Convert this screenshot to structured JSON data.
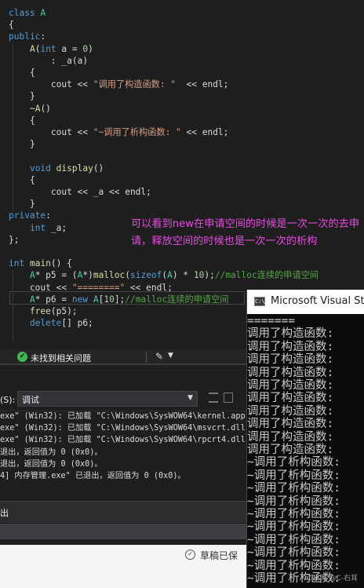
{
  "editor": {
    "lines": [
      [
        [
          "kw",
          "class"
        ],
        [
          "pl",
          " "
        ],
        [
          "ty",
          "A"
        ]
      ],
      [
        [
          "pl",
          "{"
        ]
      ],
      [
        [
          "kw",
          "public"
        ],
        [
          "pl",
          ":"
        ]
      ],
      [
        [
          "pl",
          "    "
        ],
        [
          "fn",
          "A"
        ],
        [
          "pl",
          "("
        ],
        [
          "kw",
          "int"
        ],
        [
          "pl",
          " a = "
        ],
        [
          "num",
          "0"
        ],
        [
          "pl",
          ")"
        ]
      ],
      [
        [
          "pl",
          "        : "
        ],
        [
          "mem",
          "_a"
        ],
        [
          "pl",
          "(a)"
        ]
      ],
      [
        [
          "pl",
          "    {"
        ]
      ],
      [
        [
          "pl",
          "        cout << "
        ],
        [
          "str",
          "\"调用了构造函数: \""
        ],
        [
          "pl",
          "  << endl;"
        ]
      ],
      [
        [
          "pl",
          "    }"
        ]
      ],
      [
        [
          "pl",
          "    ~"
        ],
        [
          "fn",
          "A"
        ],
        [
          "pl",
          "()"
        ]
      ],
      [
        [
          "pl",
          "    {"
        ]
      ],
      [
        [
          "pl",
          "        cout << "
        ],
        [
          "str",
          "\"~调用了析构函数: \""
        ],
        [
          "pl",
          " << endl;"
        ]
      ],
      [
        [
          "pl",
          "    }"
        ]
      ],
      [
        [
          "pl",
          ""
        ]
      ],
      [
        [
          "pl",
          "    "
        ],
        [
          "kw",
          "void"
        ],
        [
          "pl",
          " "
        ],
        [
          "fn",
          "display"
        ],
        [
          "pl",
          "()"
        ]
      ],
      [
        [
          "pl",
          "    {"
        ]
      ],
      [
        [
          "pl",
          "        cout << "
        ],
        [
          "mem",
          "_a"
        ],
        [
          "pl",
          " << endl;"
        ]
      ],
      [
        [
          "pl",
          "    }"
        ]
      ],
      [
        [
          "kw",
          "private"
        ],
        [
          "pl",
          ":"
        ]
      ],
      [
        [
          "pl",
          "    "
        ],
        [
          "kw",
          "int"
        ],
        [
          "pl",
          " "
        ],
        [
          "mem",
          "_a"
        ],
        [
          "pl",
          ";"
        ]
      ],
      [
        [
          "pl",
          "};"
        ]
      ],
      [
        [
          "pl",
          ""
        ]
      ],
      [
        [
          "kw",
          "int"
        ],
        [
          "pl",
          " "
        ],
        [
          "fn",
          "main"
        ],
        [
          "pl",
          "() {"
        ]
      ],
      [
        [
          "pl",
          "    "
        ],
        [
          "ty",
          "A"
        ],
        [
          "pl",
          "* p5 = ("
        ],
        [
          "ty",
          "A"
        ],
        [
          "pl",
          "*)"
        ],
        [
          "fn",
          "malloc"
        ],
        [
          "pl",
          "("
        ],
        [
          "kw",
          "sizeof"
        ],
        [
          "pl",
          "("
        ],
        [
          "ty",
          "A"
        ],
        [
          "pl",
          ") * "
        ],
        [
          "num",
          "10"
        ],
        [
          "pl",
          ");"
        ],
        [
          "cm",
          "//malloc连续的申请空间"
        ]
      ],
      [
        [
          "pl",
          "    cout << "
        ],
        [
          "str",
          "\"========\""
        ],
        [
          "pl",
          " << endl;"
        ]
      ],
      [
        [
          "pl",
          "    "
        ],
        [
          "ty",
          "A"
        ],
        [
          "pl",
          "* p6 = "
        ],
        [
          "kw",
          "new"
        ],
        [
          "pl",
          " "
        ],
        [
          "ty",
          "A"
        ],
        [
          "pl",
          "["
        ],
        [
          "num",
          "10"
        ],
        [
          "pl",
          "];"
        ],
        [
          "cm",
          "//malloc连续的申请空间"
        ]
      ],
      [
        [
          "pl",
          "    "
        ],
        [
          "fn",
          "free"
        ],
        [
          "pl",
          "(p5);"
        ]
      ],
      [
        [
          "pl",
          "    "
        ],
        [
          "kw",
          "delete"
        ],
        [
          "pl",
          "[] p6;"
        ]
      ]
    ],
    "annotation": "可以看到new在申请空间的时候是一次一次的去申请，释放空间的时候也是一次一次的析构"
  },
  "status_bar": {
    "issues_icon": "check-circle-icon",
    "issues_text": "未找到相关问题",
    "brush_icon": "brush-icon"
  },
  "output": {
    "source_label": "(S):",
    "source_value": "调试",
    "lines": [
      "exe\" (Win32): 已加载 \"C:\\Windows\\SysWOW64\\kernel.app",
      "exe\" (Win32): 已加载 \"C:\\Windows\\SysWOW64\\msvcrt.dll",
      "exe\" (Win32): 已加载 \"C:\\Windows\\SysWOW64\\rpcrt4.dll",
      "退出，返回值为 0 (0x0)。",
      "退出，返回值为 0 (0x0)。",
      "4] 内存管理.exe\" 已退出，返回值为 0 (0x0)。"
    ],
    "bottom_tab": "出",
    "draft_text": "草稿已保"
  },
  "console": {
    "title": "Microsoft Visual Stud",
    "lines": [
      "=======",
      "调用了构造函数:",
      "调用了构造函数:",
      "调用了构造函数:",
      "调用了构造函数:",
      "调用了构造函数:",
      "调用了构造函数:",
      "调用了构造函数:",
      "调用了构造函数:",
      "调用了构造函数:",
      "调用了构造函数:",
      "~调用了析构函数:",
      "~调用了析构函数:",
      "~调用了析构函数:",
      "~调用了析构函数:",
      "~调用了析构函数:",
      "~调用了析构函数:",
      "~调用了析构函数:",
      "~调用了析构函数:",
      "~调用了析构函数:",
      "~调用了析构函数:"
    ],
    "watermark": "CSDN @C-右耳"
  }
}
